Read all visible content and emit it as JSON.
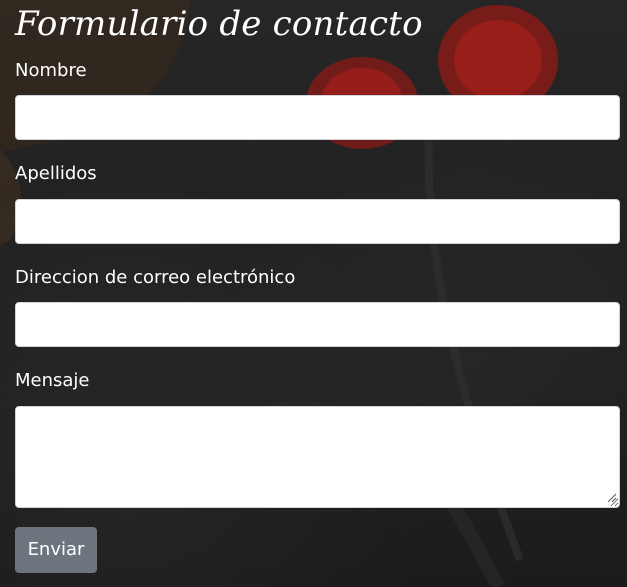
{
  "form": {
    "title": "Formulario de contacto",
    "fields": [
      {
        "label": "Nombre",
        "value": ""
      },
      {
        "label": "Apellidos",
        "value": ""
      },
      {
        "label": "Direccion de correo electrónico",
        "value": ""
      }
    ],
    "message": {
      "label": "Mensaje",
      "value": ""
    },
    "submit_label": "Enviar"
  },
  "colors": {
    "background": "#1f1f1f",
    "button": "#6c757d",
    "text": "#ffffff",
    "tomato": "#b3201b"
  },
  "icons": {
    "textarea_resize": "resize-handle-icon"
  }
}
